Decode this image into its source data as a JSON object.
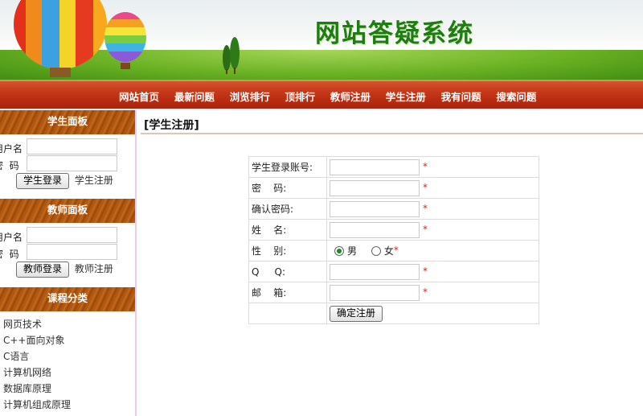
{
  "site": {
    "title": "网站答疑系统"
  },
  "nav": {
    "items": [
      "网站首页",
      "最新问题",
      "浏览排行",
      "顶排行",
      "教师注册",
      "学生注册",
      "我有问题",
      "搜索问题"
    ]
  },
  "sidebar": {
    "student_panel": {
      "title": "学生面板",
      "username_label": "用户名",
      "password_label": "密  码",
      "login_button": "学生登录",
      "register_link": "学生注册"
    },
    "teacher_panel": {
      "title": "教师面板",
      "username_label": "用户名",
      "password_label": "密  码",
      "login_button": "教师登录",
      "register_link": "教师注册"
    },
    "course_panel": {
      "title": "课程分类",
      "items": [
        "网页技术",
        "C++面向对象",
        "C语言",
        "计算机网络",
        "数据库原理",
        "计算机组成原理"
      ]
    }
  },
  "main": {
    "page_title": "[学生注册]",
    "form": {
      "account_label": "学生登录账号:",
      "password_label": "密    码:",
      "confirm_label": "确认密码:",
      "name_label": "姓    名:",
      "gender_label": "性    别:",
      "gender_options": [
        "男",
        "女"
      ],
      "gender_selected": "男",
      "qq_label": "Q     Q:",
      "email_label": "邮    箱:",
      "required_mark": "*",
      "submit_button": "确定注册"
    }
  },
  "colors": {
    "nav_red": "#c33516",
    "title_green": "#1e7c12",
    "panel_brown": "#a8520c",
    "required_red": "#e02020"
  }
}
